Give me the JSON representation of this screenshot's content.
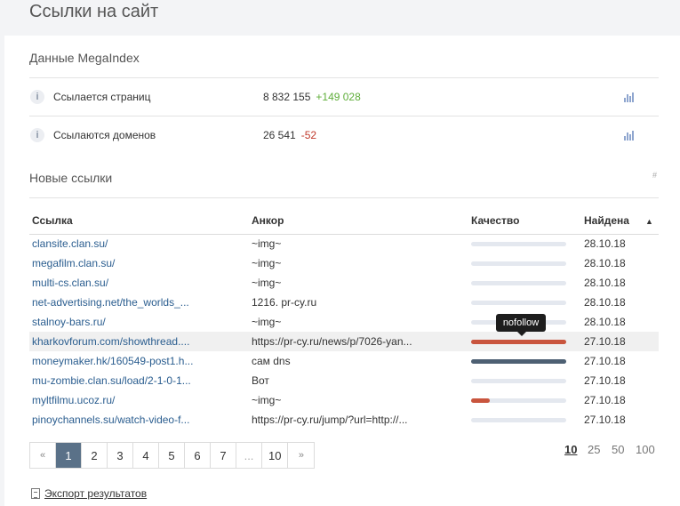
{
  "page": {
    "title": "Ссылки на сайт"
  },
  "megaindex": {
    "title": "Данные MegaIndex",
    "stats": [
      {
        "label": "Ссылается страниц",
        "value": "8 832 155",
        "delta": "+149 028",
        "trend": "up"
      },
      {
        "label": "Ссылаются доменов",
        "value": "26 541",
        "delta": "-52",
        "trend": "down"
      }
    ],
    "info_icon": "i"
  },
  "new_links": {
    "title": "Новые ссылки",
    "hash": "#",
    "columns": {
      "link": "Ссылка",
      "anchor": "Анкор",
      "quality": "Качество",
      "found": "Найдена",
      "sort_arrow": "▲"
    },
    "rows": [
      {
        "link": "clansite.clan.su/",
        "anchor": "~img~",
        "quality": 0,
        "date": "28.10.18"
      },
      {
        "link": "megafilm.clan.su/",
        "anchor": "~img~",
        "quality": 0,
        "date": "28.10.18"
      },
      {
        "link": "multi-cs.clan.su/",
        "anchor": "~img~",
        "quality": 0,
        "date": "28.10.18"
      },
      {
        "link": "net-advertising.net/the_worlds_...",
        "anchor": "1216. pr-cy.ru",
        "quality": 0,
        "date": "28.10.18"
      },
      {
        "link": "stalnoy-bars.ru/",
        "anchor": "~img~",
        "quality": 0,
        "date": "28.10.18"
      },
      {
        "link": "kharkovforum.com/showthread....",
        "anchor": "https://pr-cy.ru/news/p/7026-yan...",
        "quality": 1.0,
        "quality_color": "#c9553e",
        "date": "27.10.18"
      },
      {
        "link": "moneymaker.hk/160549-post1.h...",
        "anchor": "сам dns",
        "quality": 1.0,
        "quality_color": "#4e6073",
        "date": "27.10.18"
      },
      {
        "link": "mu-zombie.clan.su/load/2-1-0-1...",
        "anchor": "Вот",
        "quality": 0,
        "date": "27.10.18"
      },
      {
        "link": "myltfilmu.ucoz.ru/",
        "anchor": "~img~",
        "quality": 0.2,
        "quality_color": "#c9553e",
        "date": "27.10.18"
      },
      {
        "link": "pinoychannels.su/watch-video-f...",
        "anchor": "https://pr-cy.ru/jump/?url=http://...",
        "quality": 0,
        "date": "27.10.18"
      }
    ],
    "tooltip": "nofollow"
  },
  "pagination": {
    "prev": "«",
    "next": "»",
    "pages": [
      "1",
      "2",
      "3",
      "4",
      "5",
      "6",
      "7",
      "...",
      "10"
    ],
    "current": "1",
    "per_page_options": [
      "10",
      "25",
      "50",
      "100"
    ],
    "per_page_selected": "10"
  },
  "export": {
    "label": "Экспорт результатов"
  },
  "colors": {
    "accent": "#5a7188",
    "link": "#2a5d8f",
    "up": "#5fae3a",
    "down": "#c0392b"
  }
}
